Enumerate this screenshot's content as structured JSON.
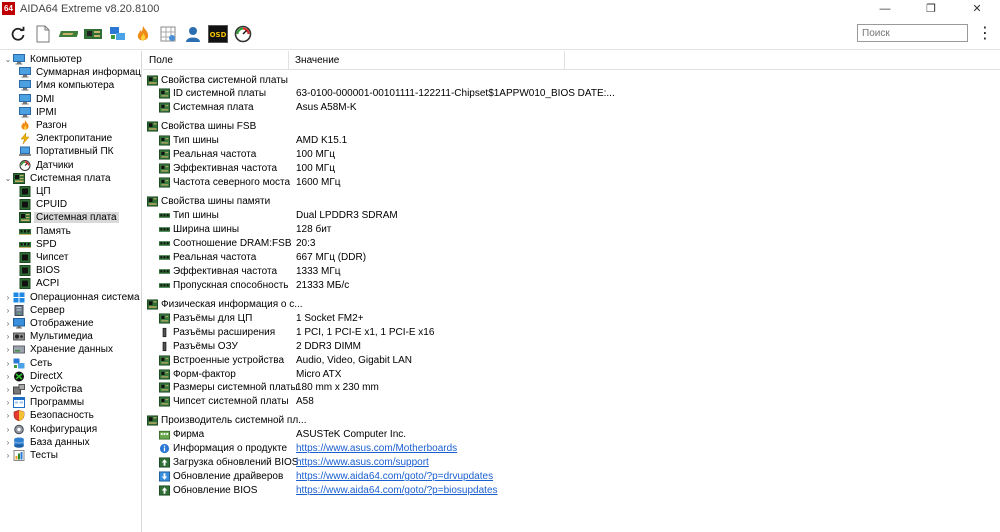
{
  "window": {
    "app_icon_text": "64",
    "title": "AIDA64 Extreme v8.20.8100",
    "minimize": "—",
    "maximize": "❐",
    "close": "✕"
  },
  "toolbar": {
    "icons": [
      "refresh-icon",
      "report-icon",
      "memory-module-icon",
      "motherboard-icon",
      "network-icon",
      "flame-icon",
      "benchmark-icon",
      "user-icon",
      "osd-icon",
      "gauge-icon"
    ],
    "osd_label": "OSD",
    "search_placeholder": "Поиск",
    "menu_glyph": "⋮"
  },
  "tree": [
    {
      "label": "Компьютер",
      "expander": "⌄",
      "icon": "computer-icon"
    },
    {
      "label": "Суммарная информация",
      "icon": "computer-icon"
    },
    {
      "label": "Имя компьютера",
      "icon": "computer-icon"
    },
    {
      "label": "DMI",
      "icon": "computer-icon"
    },
    {
      "label": "IPMI",
      "icon": "computer-icon"
    },
    {
      "label": "Разгон",
      "icon": "flame-icon"
    },
    {
      "label": "Электропитание",
      "icon": "power-icon"
    },
    {
      "label": "Портативный ПК",
      "icon": "laptop-icon"
    },
    {
      "label": "Датчики",
      "icon": "gauge-icon"
    },
    {
      "label": "Системная плата",
      "expander": "⌄",
      "icon": "motherboard-icon"
    },
    {
      "label": "ЦП",
      "icon": "chip-icon"
    },
    {
      "label": "CPUID",
      "icon": "chip-icon"
    },
    {
      "label": "Системная плата",
      "icon": "motherboard-icon",
      "selected": true
    },
    {
      "label": "Память",
      "icon": "memory-icon"
    },
    {
      "label": "SPD",
      "icon": "memory-icon"
    },
    {
      "label": "Чипсет",
      "icon": "chip-icon"
    },
    {
      "label": "BIOS",
      "icon": "chip-icon"
    },
    {
      "label": "ACPI",
      "icon": "chip-icon"
    },
    {
      "label": "Операционная система",
      "expander": "›",
      "icon": "windows-icon"
    },
    {
      "label": "Сервер",
      "expander": "›",
      "icon": "server-icon"
    },
    {
      "label": "Отображение",
      "expander": "›",
      "icon": "monitor-icon"
    },
    {
      "label": "Мультимедиа",
      "expander": "›",
      "icon": "multimedia-icon"
    },
    {
      "label": "Хранение данных",
      "expander": "›",
      "icon": "storage-icon"
    },
    {
      "label": "Сеть",
      "expander": "›",
      "icon": "network-icon"
    },
    {
      "label": "DirectX",
      "expander": "›",
      "icon": "directx-icon"
    },
    {
      "label": "Устройства",
      "expander": "›",
      "icon": "devices-icon"
    },
    {
      "label": "Программы",
      "expander": "›",
      "icon": "programs-icon"
    },
    {
      "label": "Безопасность",
      "expander": "›",
      "icon": "shield-icon"
    },
    {
      "label": "Конфигурация",
      "expander": "›",
      "icon": "config-icon"
    },
    {
      "label": "База данных",
      "expander": "›",
      "icon": "database-icon"
    },
    {
      "label": "Тесты",
      "expander": "›",
      "icon": "tests-icon"
    }
  ],
  "columns": {
    "field": "Поле",
    "value": "Значение"
  },
  "sections": [
    {
      "title": "Свойства системной платы",
      "rows": [
        {
          "field": "ID системной платы",
          "value": "63-0100-000001-00101111-122211-Chipset$1APPW010_BIOS DATE:..."
        },
        {
          "field": "Системная плата",
          "value": "Asus A58M-K"
        }
      ]
    },
    {
      "title": "Свойства шины FSB",
      "rows": [
        {
          "field": "Тип шины",
          "value": "AMD K15.1"
        },
        {
          "field": "Реальная частота",
          "value": "100 МГц"
        },
        {
          "field": "Эффективная частота",
          "value": "100 МГц"
        },
        {
          "field": "Частота северного моста",
          "value": "1600 МГц"
        }
      ]
    },
    {
      "title": "Свойства шины памяти",
      "rows": [
        {
          "field": "Тип шины",
          "value": "Dual LPDDR3 SDRAM"
        },
        {
          "field": "Ширина шины",
          "value": "128 бит"
        },
        {
          "field": "Соотношение DRAM:FSB",
          "value": "20:3"
        },
        {
          "field": "Реальная частота",
          "value": "667 МГц (DDR)"
        },
        {
          "field": "Эффективная частота",
          "value": "1333 МГц"
        },
        {
          "field": "Пропускная способность",
          "value": "21333 МБ/с"
        }
      ]
    },
    {
      "title": "Физическая информация о с...",
      "rows": [
        {
          "field": "Разъёмы для ЦП",
          "value": "1 Socket FM2+"
        },
        {
          "field": "Разъёмы расширения",
          "value": "1 PCI, 1 PCI-E x1, 1 PCI-E x16"
        },
        {
          "field": "Разъёмы ОЗУ",
          "value": "2 DDR3 DIMM"
        },
        {
          "field": "Встроенные устройства",
          "value": "Audio, Video, Gigabit LAN"
        },
        {
          "field": "Форм-фактор",
          "value": "Micro ATX"
        },
        {
          "field": "Размеры системной платы",
          "value": "180 mm x 230 mm"
        },
        {
          "field": "Чипсет системной платы",
          "value": "A58"
        }
      ]
    },
    {
      "title": "Производитель системной пл...",
      "rows": [
        {
          "field": "Фирма",
          "value": "ASUSTeK Computer Inc."
        },
        {
          "field": "Информация о продукте",
          "value": "https://www.asus.com/Motherboards",
          "link": true
        },
        {
          "field": "Загрузка обновлений BIOS",
          "value": "https://www.asus.com/support",
          "link": true
        },
        {
          "field": "Обновление драйверов",
          "value": "https://www.aida64.com/goto/?p=drvupdates",
          "link": true
        },
        {
          "field": "Обновление BIOS",
          "value": "https://www.aida64.com/goto/?p=biosupdates",
          "link": true
        }
      ]
    }
  ]
}
